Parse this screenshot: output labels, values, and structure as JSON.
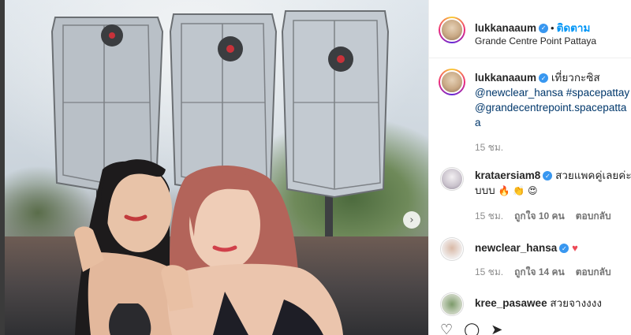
{
  "post": {
    "username": "lukkanaaum",
    "follow_label": "ติดตาม",
    "dot": "•",
    "location": "Grande Centre Point Pattaya",
    "next_icon": "›"
  },
  "caption": {
    "username": "lukkanaaum",
    "text": "เที่ยวกะซิส",
    "tag1": "@newclear_hansa",
    "tag2": "#spacepattay",
    "tag3": "@grandecentrepoint.spacepatta",
    "tag3_tail": "a",
    "time": "15 ชม."
  },
  "comments": [
    {
      "username": "krataersiam8",
      "text_line1": "สวยแพคคู่เลยค่ะ",
      "text_line2": "บบบ",
      "emojis": "🔥 👏 😍",
      "time": "15 ชม.",
      "likes": "ถูกใจ 10 คน",
      "reply": "ตอบกลับ"
    },
    {
      "username": "newclear_hansa",
      "heart": "♥",
      "time": "15 ชม.",
      "likes": "ถูกใจ 14 คน",
      "reply": "ตอบกลับ"
    },
    {
      "username": "kree_pasawee",
      "text": "สวยจางงงง"
    }
  ],
  "colors": {
    "follow": "#0095f6",
    "verified": "#3897f0",
    "heart": "#ed4956",
    "tag": "#00376b"
  },
  "icons": [
    "verified-badge-icon",
    "heart-icon",
    "comment-icon",
    "share-icon",
    "chevron-right-icon"
  ]
}
